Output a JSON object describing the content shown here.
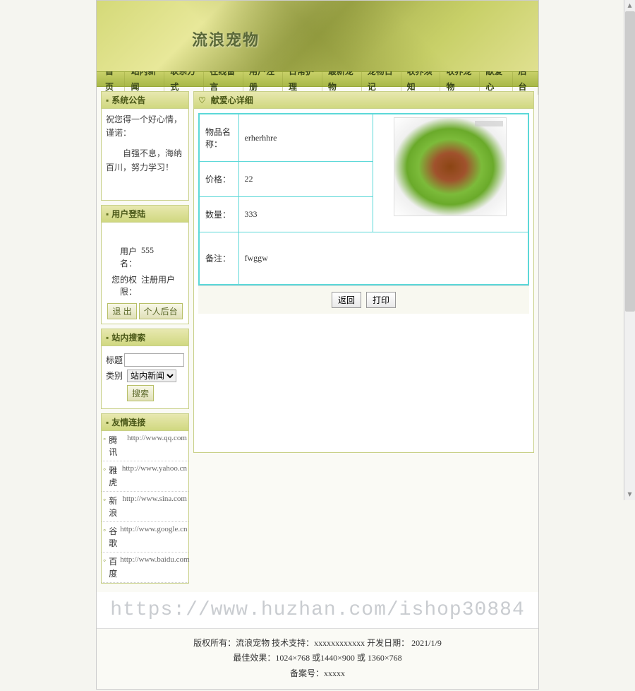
{
  "site": {
    "title": "流浪宠物"
  },
  "nav": [
    "首页",
    "站内新闻",
    "联系方式",
    "在线留言",
    "用户注册",
    "日常护理",
    "最新宠物",
    "宠物日记",
    "收养须知",
    "收养宠物",
    "献爱心",
    "后台"
  ],
  "sidebar": {
    "announce": {
      "title": "系统公告",
      "line1": "祝您得一个好心情，谨诺：",
      "line2": "自强不息，海纳百川，努力学习！"
    },
    "login": {
      "title": "用户登陆",
      "user_label": "用户名：",
      "user_value": "555",
      "perm_label": "您的权限：",
      "perm_value": "注册用户",
      "logout_btn": "退 出",
      "profile_btn": "个人后台"
    },
    "search": {
      "title": "站内搜索",
      "kw_label": "标题",
      "cat_label": "类别",
      "cat_value": "站内新闻",
      "btn": "搜索"
    },
    "links": {
      "title": "友情连接",
      "items": [
        {
          "name": "腾讯",
          "url": "http://www.qq.com"
        },
        {
          "name": "雅虎",
          "url": "http://www.yahoo.cn"
        },
        {
          "name": "新浪",
          "url": "http://www.sina.com"
        },
        {
          "name": "谷歌",
          "url": "http://www.google.cn"
        },
        {
          "name": "百度",
          "url": "http://www.baidu.com"
        }
      ]
    }
  },
  "detail": {
    "title": "献爱心详细",
    "rows": {
      "name_label": "物品名称：",
      "name_value": "erherhhre",
      "price_label": "价格：",
      "price_value": "22",
      "qty_label": "数量：",
      "qty_value": "333",
      "remark_label": "备注：",
      "remark_value": "fwggw"
    },
    "back_btn": "返回",
    "print_btn": "打印"
  },
  "watermark": "https://www.huzhan.com/ishop30884",
  "footer": {
    "line1": "版权所有：流浪宠物 技术支持：xxxxxxxxxxxx 开发日期： 2021/1/9",
    "line2": "最佳效果：1024×768 或1440×900 或 1360×768",
    "line3": "备案号：xxxxx"
  }
}
